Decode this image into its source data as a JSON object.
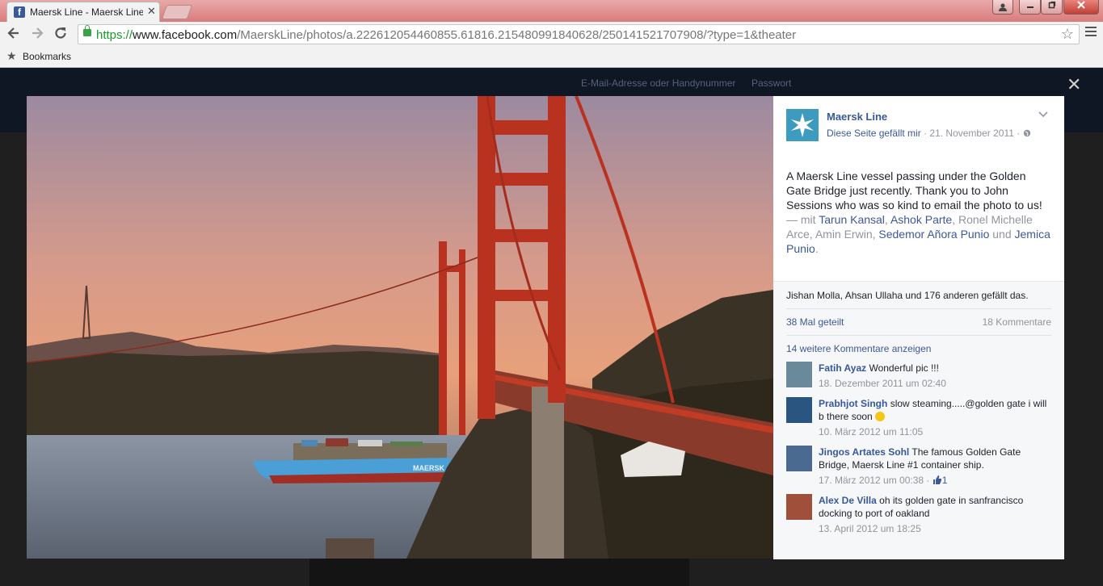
{
  "browser": {
    "tab_title": "Maersk Line - Maersk Line",
    "tab_close": "✕",
    "url_scheme": "https://",
    "url_host": "www.facebook.com",
    "url_path": "/MaerskLine/photos/a.222612054460855.61816.215480991840628/250141521707908/?type=1&theater",
    "bookmarks_label": "Bookmarks"
  },
  "fb_bar": {
    "email_label": "E-Mail-Adresse oder Handynummer",
    "password_label": "Passwort"
  },
  "overlay": {
    "close": "✕"
  },
  "post": {
    "page_name": "Maersk Line",
    "like_page": "Diese Seite gefällt mir",
    "date": "21. November 2011",
    "text": "A Maersk Line vessel passing under the Golden Gate Bridge just recently. Thank you to John Sessions who was so kind to email the photo to us!",
    "with_prefix": " — mit ",
    "tags": [
      "Tarun Kansal",
      "Ashok Parte",
      "Ronel Michelle Arce",
      "Amin Erwin",
      "Sedemor Añora Punio",
      "Jemica Punio"
    ],
    "and_word": "und"
  },
  "ufi": {
    "likes": "Jishan Molla, Ahsan Ullaha und 176 anderen gefällt das.",
    "shares": "38 Mal geteilt",
    "comments_count": "18 Kommentare",
    "more_comments": "14 weitere Kommentare anzeigen"
  },
  "comments": [
    {
      "name": "Fatih Ayaz",
      "text": "Wonderful pic !!!",
      "time": "18. Dezember 2011 um 02:40",
      "likes": ""
    },
    {
      "name": "Prabhjot Singh",
      "text": "slow steaming.....@golden gate i will b there soon",
      "time": "10. März 2012 um 11:05",
      "likes": ""
    },
    {
      "name": "Jingos Artates Sohl",
      "text": "The famous Golden Gate Bridge, Maersk Line #1 container ship.",
      "time": "17. März 2012 um 00:38",
      "likes": "1"
    },
    {
      "name": "Alex De Villa",
      "text": "oh its golden gate in sanfrancisco docking to port of oakland",
      "time": "13. April 2012 um 18:25",
      "likes": ""
    }
  ],
  "photo": {
    "ship_name": "MAERSK"
  },
  "colors": {
    "fb_blue": "#3b5998",
    "bridge": "#b8321f",
    "ship_hull": "#4a9fd6"
  },
  "icons": [
    "back-icon",
    "forward-icon",
    "reload-icon",
    "lock-icon",
    "star-icon",
    "menu-icon",
    "globe-icon",
    "thumbs-up-icon",
    "chevron-down-icon",
    "close-icon"
  ]
}
